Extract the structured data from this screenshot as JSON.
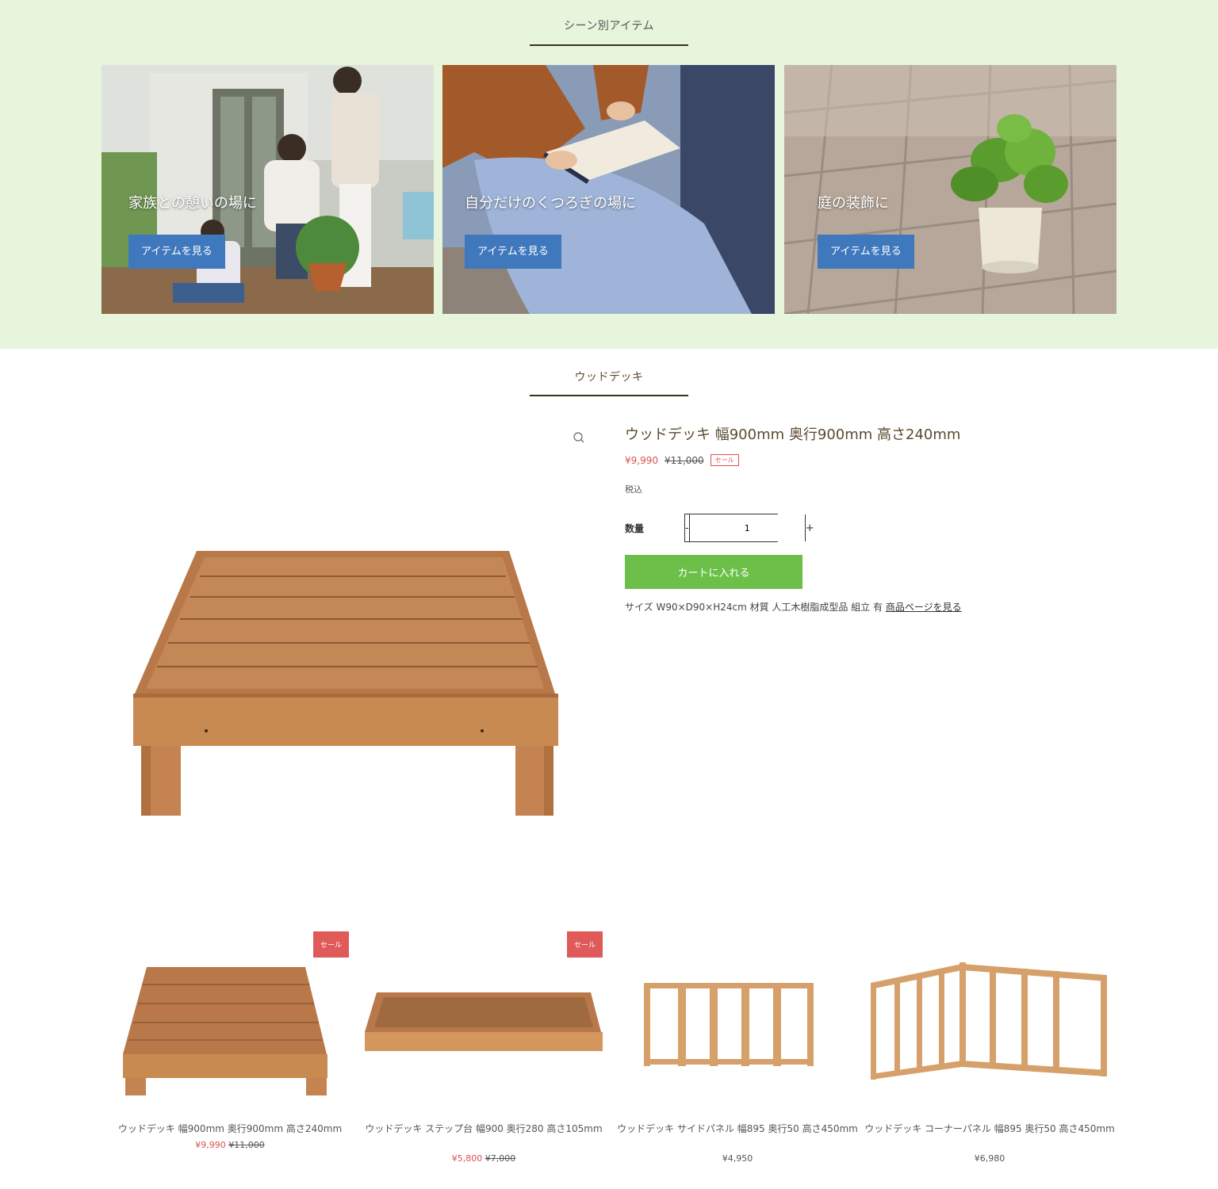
{
  "scene": {
    "title": "シーン別アイテム",
    "cards": [
      {
        "label": "家族との憩いの場に",
        "button": "アイテムを見る"
      },
      {
        "label": "自分だけのくつろぎの場に",
        "button": "アイテムを見る"
      },
      {
        "label": "庭の装飾に",
        "button": "アイテムを見る"
      }
    ]
  },
  "featured": {
    "section_title": "ウッドデッキ",
    "product_title": "ウッドデッキ 幅900mm 奥行900mm 高さ240mm",
    "price_sale": "¥9,990",
    "price_original": "¥11,000",
    "sale_badge": "セール",
    "tax_label": "税込",
    "quantity_label": "数量",
    "qty_minus": "-",
    "qty_value": "1",
    "qty_plus": "+",
    "cart_button": "カートに入れる",
    "spec_text": "サイズ W90×D90×H24cm 材質 人工木樹脂成型品 組立 有",
    "spec_link": "商品ページを見る",
    "zoom_icon": "magnifier-icon"
  },
  "related": [
    {
      "name": "ウッドデッキ 幅900mm 奥行900mm 高さ240mm",
      "price_sale": "¥9,990",
      "price_original": "¥11,000",
      "badge": "セール"
    },
    {
      "name": "ウッドデッキ ステップ台 幅900 奥行280 高さ105mm",
      "price_sale": "¥5,800",
      "price_original": "¥7,000",
      "badge": "セール"
    },
    {
      "name": "ウッドデッキ サイドパネル 幅895 奥行50 高さ450mm",
      "price": "¥4,950"
    },
    {
      "name": "ウッドデッキ コーナーパネル 幅895 奥行50 高さ450mm",
      "price": "¥6,980"
    }
  ],
  "colors": {
    "scene_bg": "#e6f5dc",
    "button_blue": "#3f78bd",
    "cart_green": "#6cc04a",
    "sale_red": "#d9534f",
    "wood": "#c98a52"
  }
}
